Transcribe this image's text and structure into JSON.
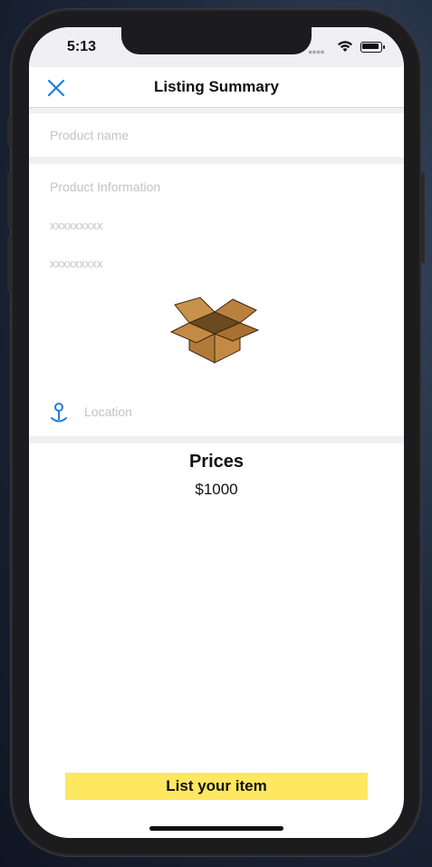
{
  "status_bar": {
    "time": "5:13"
  },
  "nav": {
    "title": "Listing Summary",
    "close_icon": "close-icon"
  },
  "form": {
    "product_name_placeholder": "Product name",
    "product_info_placeholder": "Product Information",
    "line1_placeholder": "xxxxxxxxx",
    "line2_placeholder": "xxxxxxxxx",
    "location_placeholder": "Location",
    "image_icon": "cardboard-box-image",
    "location_icon": "map-pin-icon"
  },
  "prices": {
    "title": "Prices",
    "value": "$1000"
  },
  "cta": {
    "label": "List your item"
  },
  "colors": {
    "accent": "#1a7ee6",
    "button": "#fee761",
    "gap": "#efeff4"
  }
}
